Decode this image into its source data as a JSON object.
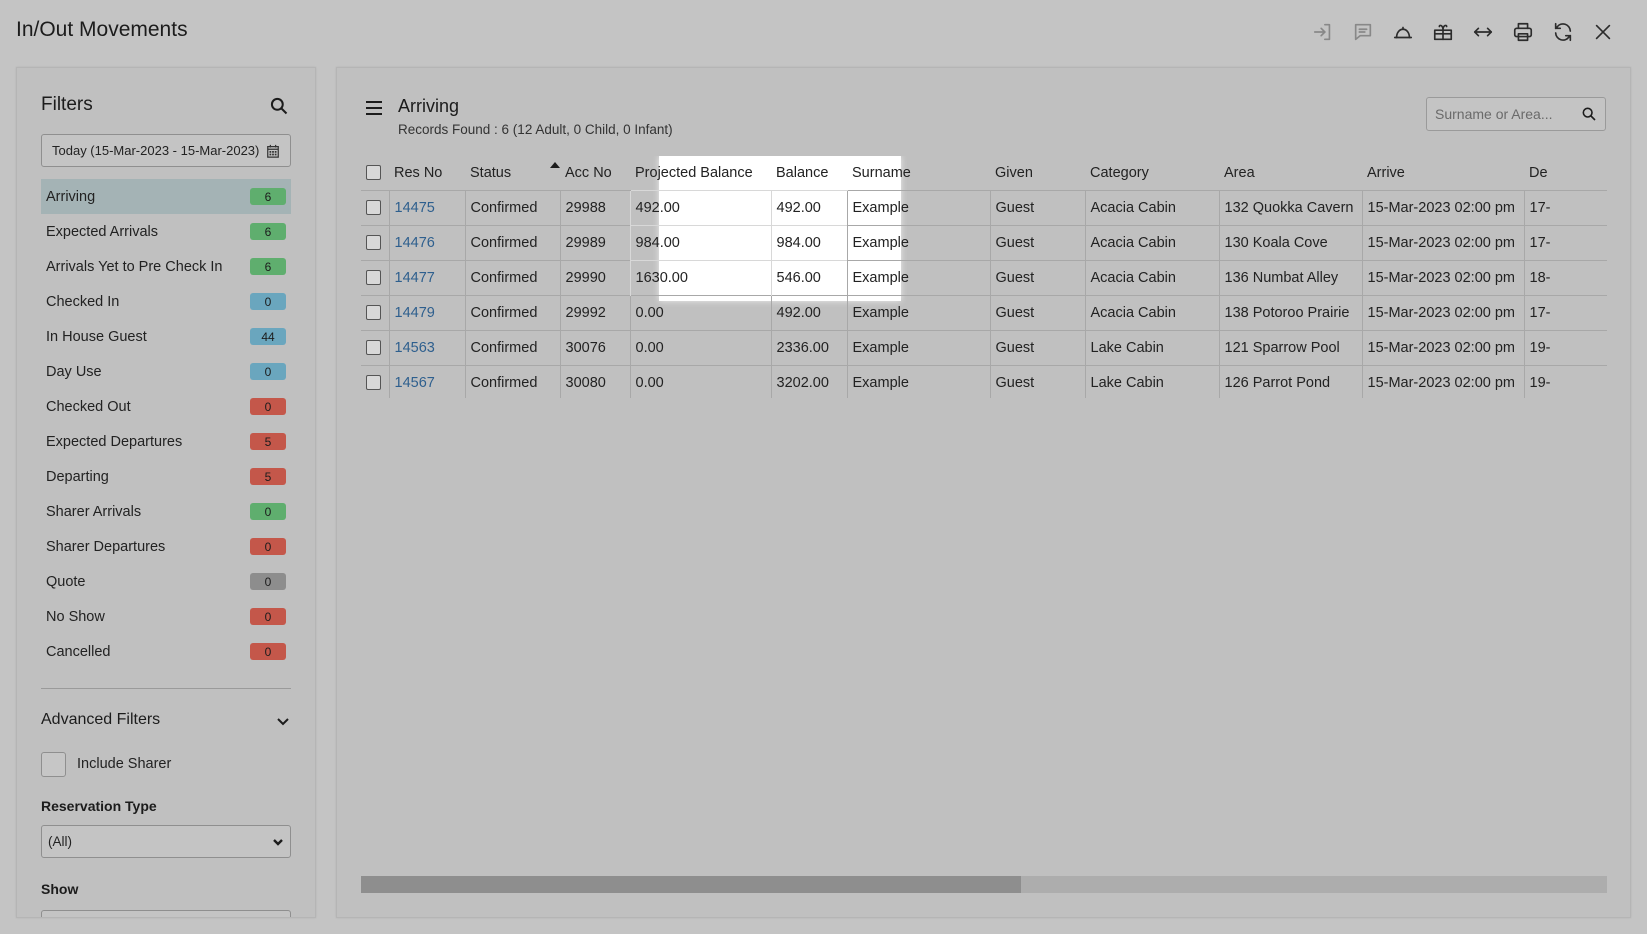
{
  "page": {
    "title": "In/Out Movements"
  },
  "toolbar": {
    "icons": [
      "sign-in-icon",
      "comment-icon",
      "bell-icon",
      "arrivals-gift-icon",
      "arrows-horizontal-icon",
      "print-icon",
      "refresh-icon",
      "close-icon"
    ]
  },
  "filters": {
    "title": "Filters",
    "date_range": "Today (15-Mar-2023 - 15-Mar-2023)",
    "items": [
      {
        "label": "Arriving",
        "count": "6",
        "color": "green",
        "active": true
      },
      {
        "label": "Expected Arrivals",
        "count": "6",
        "color": "green"
      },
      {
        "label": "Arrivals Yet to Pre Check In",
        "count": "6",
        "color": "green"
      },
      {
        "label": "Checked In",
        "count": "0",
        "color": "blue"
      },
      {
        "label": "In House Guest",
        "count": "44",
        "color": "blue"
      },
      {
        "label": "Day Use",
        "count": "0",
        "color": "blue"
      },
      {
        "label": "Checked Out",
        "count": "0",
        "color": "red"
      },
      {
        "label": "Expected Departures",
        "count": "5",
        "color": "red"
      },
      {
        "label": "Departing",
        "count": "5",
        "color": "red"
      },
      {
        "label": "Sharer Arrivals",
        "count": "0",
        "color": "green"
      },
      {
        "label": "Sharer Departures",
        "count": "0",
        "color": "red"
      },
      {
        "label": "Quote",
        "count": "0",
        "color": "grey"
      },
      {
        "label": "No Show",
        "count": "0",
        "color": "red"
      },
      {
        "label": "Cancelled",
        "count": "0",
        "color": "red"
      }
    ],
    "advanced_title": "Advanced Filters",
    "include_sharer_label": "Include Sharer",
    "reservation_type_label": "Reservation Type",
    "reservation_type_value": "(All)",
    "show_label": "Show"
  },
  "main": {
    "title": "Arriving",
    "records_found": "Records Found : 6 (12 Adult, 0 Child, 0 Infant)",
    "search_placeholder": "Surname or Area...",
    "columns": [
      "Res No",
      "Status",
      "Acc No",
      "Projected Balance",
      "Balance",
      "Surname",
      "Given",
      "Category",
      "Area",
      "Arrive",
      "De"
    ],
    "rows": [
      [
        "14475",
        "Confirmed",
        "29988",
        "492.00",
        "492.00",
        "Example",
        "Guest",
        "Acacia Cabin",
        "132 Quokka Cavern",
        "15-Mar-2023 02:00 pm",
        "17-"
      ],
      [
        "14476",
        "Confirmed",
        "29989",
        "984.00",
        "984.00",
        "Example",
        "Guest",
        "Acacia Cabin",
        "130 Koala Cove",
        "15-Mar-2023 02:00 pm",
        "17-"
      ],
      [
        "14477",
        "Confirmed",
        "29990",
        "1630.00",
        "546.00",
        "Example",
        "Guest",
        "Acacia Cabin",
        "136 Numbat Alley",
        "15-Mar-2023 02:00 pm",
        "18-"
      ],
      [
        "14479",
        "Confirmed",
        "29992",
        "0.00",
        "492.00",
        "Example",
        "Guest",
        "Acacia Cabin",
        "138 Potoroo Prairie",
        "15-Mar-2023 02:00 pm",
        "17-"
      ],
      [
        "14563",
        "Confirmed",
        "30076",
        "0.00",
        "2336.00",
        "Example",
        "Guest",
        "Lake Cabin",
        "121 Sparrow Pool",
        "15-Mar-2023 02:00 pm",
        "19-"
      ],
      [
        "14567",
        "Confirmed",
        "30080",
        "0.00",
        "3202.00",
        "Example",
        "Guest",
        "Lake Cabin",
        "126 Parrot Pond",
        "15-Mar-2023 02:00 pm",
        "19-"
      ]
    ],
    "scroll_fraction": 0.53
  }
}
